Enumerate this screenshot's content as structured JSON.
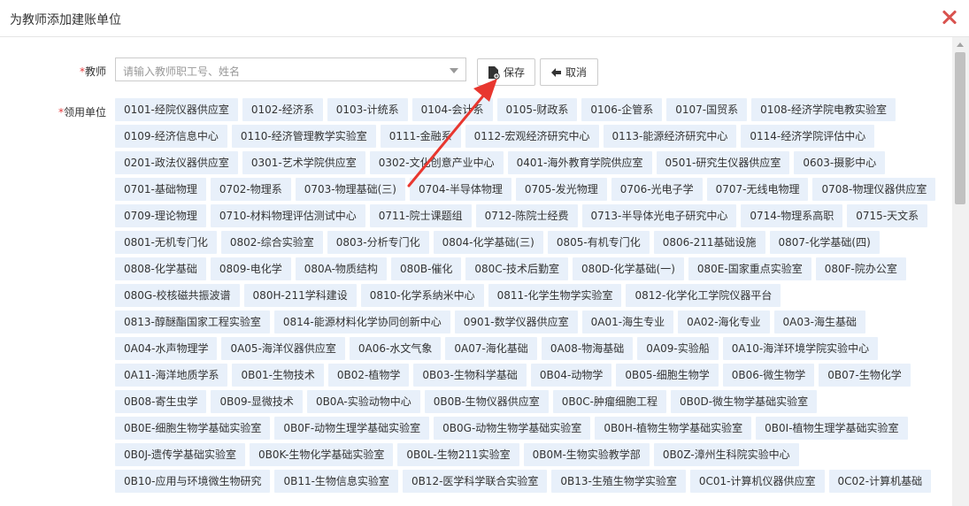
{
  "dialog": {
    "title": "为教师添加建账单位"
  },
  "form": {
    "teacher_label": "教师",
    "teacher_placeholder": "请输入教师职工号、姓名",
    "unit_label": "领用单位",
    "required_mark": "*"
  },
  "buttons": {
    "save": "保存",
    "cancel": "取消"
  },
  "units": [
    [
      "0101-经院仪器供应室",
      "0102-经济系",
      "0103-计统系",
      "0104-会计系",
      "0105-财政系",
      "0106-企管系",
      "0107-国贸系",
      "0108-经济学院电教实验室"
    ],
    [
      "0109-经济信息中心",
      "0110-经济管理教学实验室",
      "0111-金融系",
      "0112-宏观经济研究中心",
      "0113-能源经济研究中心",
      "0114-经济学院评估中心"
    ],
    [
      "0201-政法仪器供应室",
      "0301-艺术学院供应室",
      "0302-文化创意产业中心",
      "0401-海外教育学院供应室",
      "0501-研究生仪器供应室",
      "0603-摄影中心"
    ],
    [
      "0701-基础物理",
      "0702-物理系",
      "0703-物理基础(三)",
      "0704-半导体物理",
      "0705-发光物理",
      "0706-光电子学",
      "0707-无线电物理",
      "0708-物理仪器供应室"
    ],
    [
      "0709-理论物理",
      "0710-材料物理评估测试中心",
      "0711-院士课题组",
      "0712-陈院士经费",
      "0713-半导体光电子研究中心",
      "0714-物理系高职",
      "0715-天文系"
    ],
    [
      "0801-无机专门化",
      "0802-综合实验室",
      "0803-分析专门化",
      "0804-化学基础(三)",
      "0805-有机专门化",
      "0806-211基础设施",
      "0807-化学基础(四)"
    ],
    [
      "0808-化学基础",
      "0809-电化学",
      "080A-物质结构",
      "080B-催化",
      "080C-技术后勤室",
      "080D-化学基础(一)",
      "080E-国家重点实验室",
      "080F-院办公室"
    ],
    [
      "080G-校核磁共振波谱",
      "080H-211学科建设",
      "0810-化学系纳米中心",
      "0811-化学生物学实验室",
      "0812-化学化工学院仪器平台"
    ],
    [
      "0813-醇醚酯国家工程实验室",
      "0814-能源材料化学协同创新中心",
      "0901-数学仪器供应室",
      "0A01-海生专业",
      "0A02-海化专业",
      "0A03-海生基础"
    ],
    [
      "0A04-水声物理学",
      "0A05-海洋仪器供应室",
      "0A06-水文气象",
      "0A07-海化基础",
      "0A08-物海基础",
      "0A09-实验船",
      "0A10-海洋环境学院实验中心"
    ],
    [
      "0A11-海洋地质学系",
      "0B01-生物技术",
      "0B02-植物学",
      "0B03-生物科学基础",
      "0B04-动物学",
      "0B05-细胞生物学",
      "0B06-微生物学",
      "0B07-生物化学"
    ],
    [
      "0B08-寄生虫学",
      "0B09-显微技术",
      "0B0A-实验动物中心",
      "0B0B-生物仪器供应室",
      "0B0C-肿瘤细胞工程",
      "0B0D-微生物学基础实验室"
    ],
    [
      "0B0E-细胞生物学基础实验室",
      "0B0F-动物生理学基础实验室",
      "0B0G-动物生物学基础实验室",
      "0B0H-植物生物学基础实验室",
      "0B0I-植物生理学基础实验室"
    ],
    [
      "0B0J-遗传学基础实验室",
      "0B0K-生物化学基础实验室",
      "0B0L-生物211实验室",
      "0B0M-生物实验教学部",
      "0B0Z-漳州生科院实验中心"
    ],
    [
      "0B10-应用与环境微生物研究",
      "0B11-生物信息实验室",
      "0B12-医学科学联合实验室",
      "0B13-生殖生物学实验室",
      "0C01-计算机仪器供应室",
      "0C02-计算机基础"
    ]
  ],
  "colors": {
    "tag_bg": "#e8f0fa",
    "close": "#d9534f",
    "required": "#e4393c",
    "annotation_arrow": "#e8372f"
  }
}
